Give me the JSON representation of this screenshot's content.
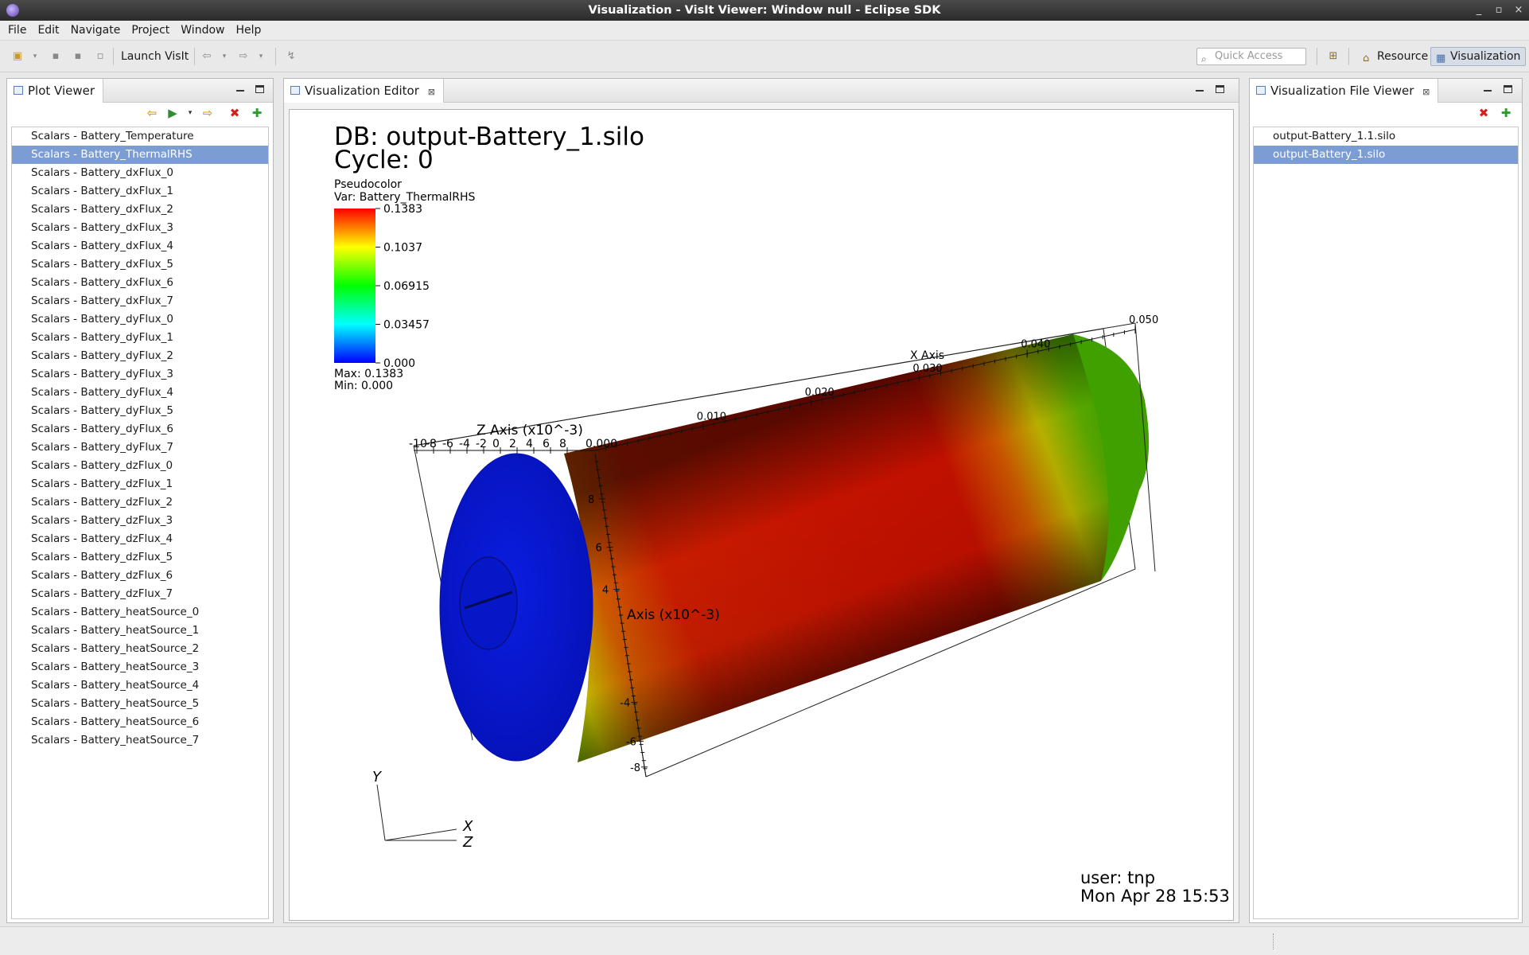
{
  "window": {
    "title": "Visualization - VisIt Viewer: Window null - Eclipse SDK",
    "controls": [
      "_",
      "▫",
      "×"
    ]
  },
  "menu": [
    "File",
    "Edit",
    "Navigate",
    "Project",
    "Window",
    "Help"
  ],
  "toolbar": {
    "launch_label": "Launch VisIt",
    "quick_access_placeholder": "Quick Access",
    "perspectives": [
      "Resource",
      "Visualization"
    ],
    "active_perspective": "Visualization"
  },
  "plot_viewer": {
    "title": "Plot Viewer",
    "selected_index": 1,
    "items": [
      "Scalars - Battery_Temperature",
      "Scalars - Battery_ThermalRHS",
      "Scalars - Battery_dxFlux_0",
      "Scalars - Battery_dxFlux_1",
      "Scalars - Battery_dxFlux_2",
      "Scalars - Battery_dxFlux_3",
      "Scalars - Battery_dxFlux_4",
      "Scalars - Battery_dxFlux_5",
      "Scalars - Battery_dxFlux_6",
      "Scalars - Battery_dxFlux_7",
      "Scalars - Battery_dyFlux_0",
      "Scalars - Battery_dyFlux_1",
      "Scalars - Battery_dyFlux_2",
      "Scalars - Battery_dyFlux_3",
      "Scalars - Battery_dyFlux_4",
      "Scalars - Battery_dyFlux_5",
      "Scalars - Battery_dyFlux_6",
      "Scalars - Battery_dyFlux_7",
      "Scalars - Battery_dzFlux_0",
      "Scalars - Battery_dzFlux_1",
      "Scalars - Battery_dzFlux_2",
      "Scalars - Battery_dzFlux_3",
      "Scalars - Battery_dzFlux_4",
      "Scalars - Battery_dzFlux_5",
      "Scalars - Battery_dzFlux_6",
      "Scalars - Battery_dzFlux_7",
      "Scalars - Battery_heatSource_0",
      "Scalars - Battery_heatSource_1",
      "Scalars - Battery_heatSource_2",
      "Scalars - Battery_heatSource_3",
      "Scalars - Battery_heatSource_4",
      "Scalars - Battery_heatSource_5",
      "Scalars - Battery_heatSource_6",
      "Scalars - Battery_heatSource_7"
    ]
  },
  "editor": {
    "tab_title": "Visualization Editor",
    "close_glyph": "⊠",
    "db_line": "DB: output-Battery_1.silo",
    "cycle_line": "Cycle: 0",
    "legend": {
      "plot_type": "Pseudocolor",
      "var_line": "Var: Battery_ThermalRHS",
      "ticks": [
        "0.1383",
        "0.1037",
        "0.06915",
        "0.03457",
        "0.000"
      ],
      "max_line": "Max:  0.1383",
      "min_line": "Min:  0.000",
      "colors": [
        "#ff0000",
        "#ffff00",
        "#00ff00",
        "#00ffff",
        "#0000ff"
      ]
    },
    "axes": {
      "z_title": "Z Axis (x10^-3)",
      "z_ticks": [
        "-10",
        "-8",
        "-6",
        "-4",
        "-2",
        "0",
        "2",
        "4",
        "6",
        "8"
      ],
      "x_title": "X Axis",
      "x_ticks": [
        "0.000",
        "0.010",
        "0.020",
        "0.030",
        "0.040",
        "0.050"
      ],
      "y_title": "Axis (x10^-3)",
      "y_ticks": [
        "8",
        "6",
        "4",
        "-4",
        "-6",
        "-8"
      ],
      "triad": [
        "Y",
        "X",
        "Z"
      ]
    },
    "user_line": "user: tnp",
    "date_line": "Mon Apr 28 15:53"
  },
  "file_viewer": {
    "title": "Visualization File Viewer",
    "selected_index": 1,
    "items": [
      "output-Battery_1.1.silo",
      "output-Battery_1.silo"
    ]
  }
}
